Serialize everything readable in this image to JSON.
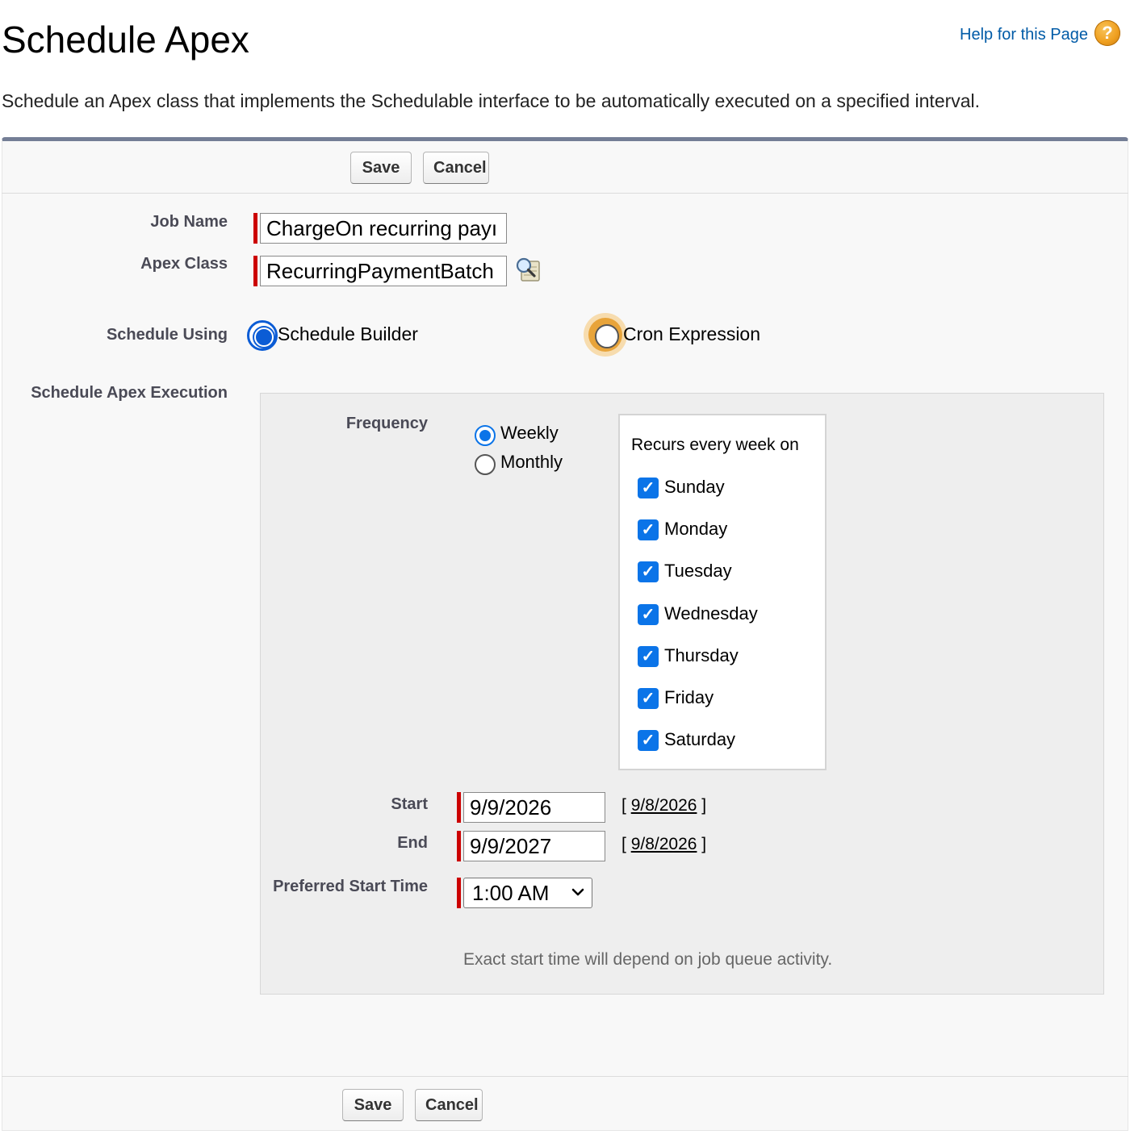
{
  "page": {
    "title": "Schedule Apex",
    "help_link": "Help for this Page",
    "help_icon": "?",
    "description": "Schedule an Apex class that implements the Schedulable interface to be automatically executed on a specified interval."
  },
  "buttons": {
    "save": "Save",
    "cancel": "Cancel"
  },
  "form": {
    "job_name_label": "Job Name",
    "job_name_value": "ChargeOn recurring payı",
    "apex_class_label": "Apex Class",
    "apex_class_value": "RecurringPaymentBatch",
    "schedule_using_label": "Schedule Using",
    "schedule_builder_label": "Schedule Builder",
    "cron_expression_label": "Cron Expression",
    "schedule_using_selected": "Schedule Builder",
    "schedule_execution_label": "Schedule Apex Execution"
  },
  "execution": {
    "frequency_label": "Frequency",
    "weekly_label": "Weekly",
    "monthly_label": "Monthly",
    "frequency_selected": "Weekly",
    "recurs_label": "Recurs every week on",
    "days": [
      {
        "label": "Sunday",
        "checked": true
      },
      {
        "label": "Monday",
        "checked": true
      },
      {
        "label": "Tuesday",
        "checked": true
      },
      {
        "label": "Wednesday",
        "checked": true
      },
      {
        "label": "Thursday",
        "checked": true
      },
      {
        "label": "Friday",
        "checked": true
      },
      {
        "label": "Saturday",
        "checked": true
      }
    ],
    "start_label": "Start",
    "start_value": "9/9/2026",
    "start_today_link": "9/8/2026",
    "end_label": "End",
    "end_value": "9/9/2027",
    "end_today_link": "9/8/2026",
    "bracket_open": "[",
    "bracket_close": "]",
    "preferred_time_label": "Preferred Start Time",
    "preferred_time_value": "1:00 AM",
    "note": "Exact start time will depend on job queue activity."
  },
  "colors": {
    "link": "#015ba7",
    "required": "#cc0000",
    "accent": "#0b74e8",
    "panel_top_border": "#747e96"
  }
}
